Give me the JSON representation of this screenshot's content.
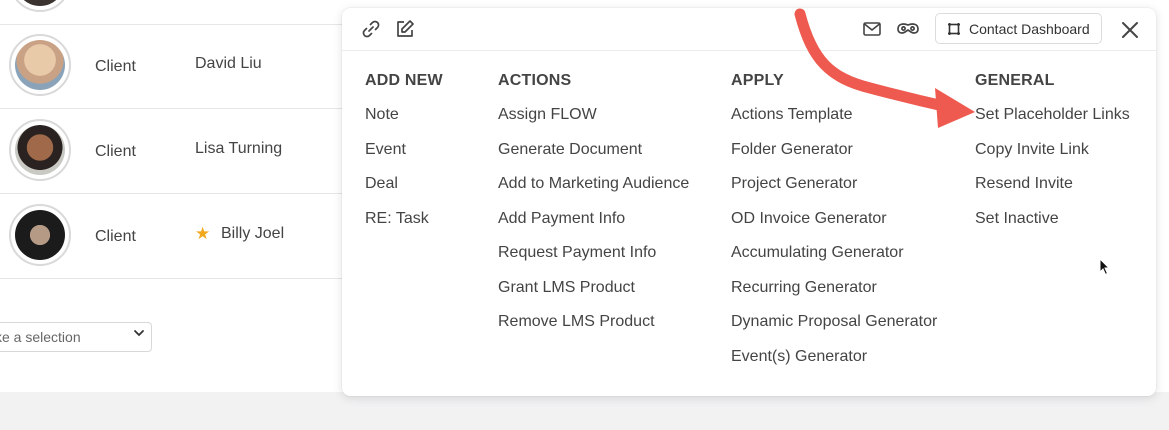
{
  "contacts": [
    {
      "type": "Client",
      "name": "David Liu",
      "starred": false
    },
    {
      "type": "Client",
      "name": "Lisa Turning",
      "starred": false
    },
    {
      "type": "Client",
      "name": "Billy Joel",
      "starred": true
    }
  ],
  "select": {
    "text": "ke a selection"
  },
  "toolbar": {
    "contact_dashboard_label": "Contact Dashboard"
  },
  "columns": {
    "add_new": {
      "heading": "ADD NEW",
      "items": [
        "Note",
        "Event",
        "Deal",
        "RE: Task"
      ]
    },
    "actions": {
      "heading": "ACTIONS",
      "items": [
        "Assign FLOW",
        "Generate Document",
        "Add to Marketing Audience",
        "Add Payment Info",
        "Request Payment Info",
        "Grant LMS Product",
        "Remove LMS Product"
      ]
    },
    "apply": {
      "heading": "APPLY",
      "items": [
        "Actions Template",
        "Folder Generator",
        "Project Generator",
        "OD Invoice Generator",
        "Accumulating Generator",
        "Recurring Generator",
        "Dynamic Proposal Generator",
        "Event(s) Generator"
      ]
    },
    "general": {
      "heading": "GENERAL",
      "items": [
        "Set Placeholder Links",
        "Copy Invite Link",
        "Resend Invite",
        "Set Inactive"
      ]
    }
  },
  "colors": {
    "annotation_arrow": "#ee5a4f",
    "star": "#f2a81d"
  }
}
